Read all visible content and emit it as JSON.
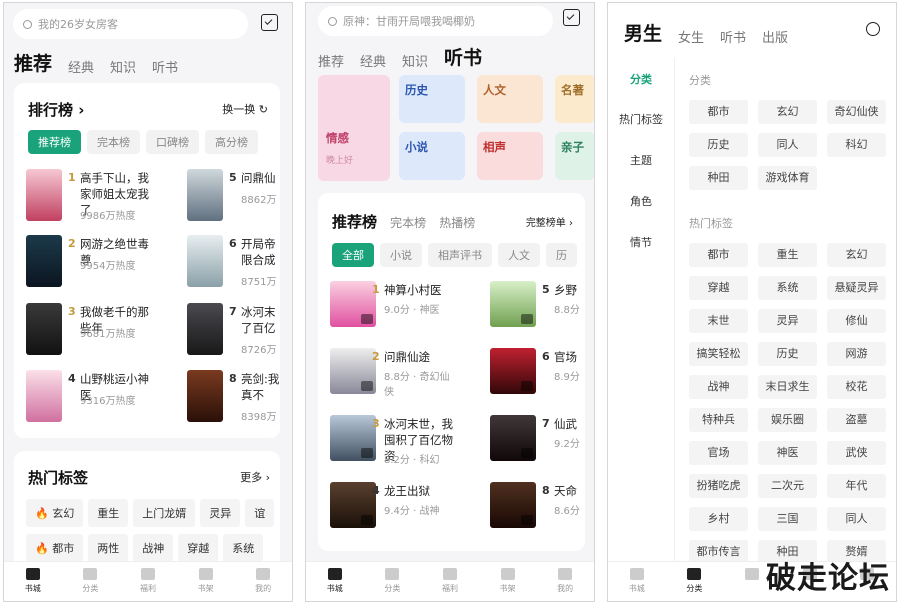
{
  "p1": {
    "search": "我的26岁女房客",
    "tabs": [
      "推荐",
      "经典",
      "知识",
      "听书"
    ],
    "rank_title": "排行榜 ›",
    "rank_swap": "换一换 ↻",
    "rank_tabs": [
      "推荐榜",
      "完本榜",
      "口碑榜",
      "高分榜"
    ],
    "books": [
      {
        "rank": "1",
        "title": "高手下山，我家师姐太宠我了",
        "heat": "9986万热度"
      },
      {
        "rank": "2",
        "title": "网游之绝世毒尊",
        "heat": "9954万热度"
      },
      {
        "rank": "3",
        "title": "我做老千的那些年",
        "heat": "9681万热度"
      },
      {
        "rank": "4",
        "title": "山野桃运小神医",
        "heat": "9316万热度"
      },
      {
        "rank": "5",
        "title": "问鼎仙",
        "heat": "8862万"
      },
      {
        "rank": "6",
        "title": "开局帝限合成",
        "heat": "8751万"
      },
      {
        "rank": "7",
        "title": "冰河末了百亿",
        "heat": "8726万"
      },
      {
        "rank": "8",
        "title": "亮剑:我真不",
        "heat": "8398万"
      }
    ],
    "hot_title": "热门标签",
    "hot_more": "更多 ›",
    "tags": [
      [
        "🔥 玄幻",
        "重生",
        "上门龙婿",
        "灵异",
        "谊"
      ],
      [
        "🔥 都市",
        "两性",
        "战神",
        "穿越",
        "系统"
      ]
    ],
    "nav": [
      "书城",
      "分类",
      "福利",
      "书架",
      "我的"
    ]
  },
  "p2": {
    "search": "原神：甘雨开局喂我喝椰奶",
    "tabs": [
      "推荐",
      "经典",
      "知识",
      "听书"
    ],
    "cats": [
      "历史",
      "人文",
      "名著",
      "小说",
      "相声",
      "亲子"
    ],
    "feature": "情感",
    "feature_sub": "晚上好",
    "rank_tabs": [
      "推荐榜",
      "完本榜",
      "热播榜"
    ],
    "full": "完整榜单 ›",
    "filters": [
      "全部",
      "小说",
      "相声评书",
      "人文",
      "历"
    ],
    "books": [
      {
        "rank": "1",
        "title": "神算小村医",
        "meta": "9.0分 · 神医"
      },
      {
        "rank": "2",
        "title": "问鼎仙途",
        "meta": "8.8分 · 奇幻仙侠"
      },
      {
        "rank": "3",
        "title": "冰河末世，我囤积了百亿物资",
        "meta": "8.2分 · 科幻"
      },
      {
        "rank": "4",
        "title": "龙王出狱",
        "meta": "9.4分 · 战神"
      },
      {
        "rank": "5",
        "title": "乡野",
        "meta": "8.8分"
      },
      {
        "rank": "6",
        "title": "官场",
        "meta": "8.9分"
      },
      {
        "rank": "7",
        "title": "仙武",
        "meta": "9.2分"
      },
      {
        "rank": "8",
        "title": "天命",
        "meta": "8.6分"
      }
    ],
    "nav": [
      "书城",
      "分类",
      "福利",
      "书架",
      "我的"
    ]
  },
  "p3": {
    "tabs": [
      "男生",
      "女生",
      "听书",
      "出版"
    ],
    "side": [
      "分类",
      "热门标签",
      "主题",
      "角色",
      "情节"
    ],
    "sec1": "分类",
    "cats": [
      "都市",
      "玄幻",
      "奇幻仙侠",
      "历史",
      "同人",
      "科幻",
      "种田",
      "游戏体育"
    ],
    "sec2": "热门标签",
    "tags": [
      "都市",
      "重生",
      "玄幻",
      "穿越",
      "系统",
      "悬疑灵异",
      "末世",
      "灵异",
      "修仙",
      "搞笑轻松",
      "历史",
      "网游",
      "战神",
      "末日求生",
      "校花",
      "特种兵",
      "娱乐圈",
      "盗墓",
      "官场",
      "神医",
      "武侠",
      "扮猪吃虎",
      "二次元",
      "年代",
      "乡村",
      "三国",
      "同人",
      "都市传言",
      "种田",
      "赘婿"
    ],
    "nav": [
      "书城",
      "分类"
    ],
    "watermark": "破走论坛"
  },
  "colors": {
    "accent": "#1aa37a",
    "gold": "#c49a3c"
  }
}
